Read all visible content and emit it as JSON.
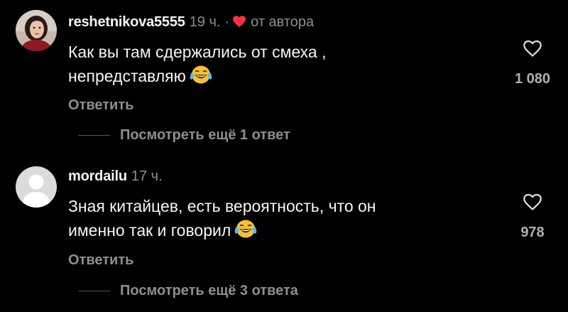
{
  "colors": {
    "background": "#000000",
    "text": "#f5f5f5",
    "muted": "#8e8e8e",
    "heart_red": "#ff3040"
  },
  "comments": [
    {
      "username": "reshetnikova5555",
      "time": "19 ч.",
      "separator": "·",
      "author_like": "от автора",
      "text_line1": "Как вы там сдержались от смеха ,",
      "text_line2": "непредставляю",
      "emoji": "face-with-tears-of-joy-icon",
      "reply_label": "Ответить",
      "view_replies_label": "Посмотреть ещё 1 ответ",
      "like_count": "1 080"
    },
    {
      "username": "mordailu",
      "time": "17 ч.",
      "text_line1": "Зная китайцев, есть вероятность, что он",
      "text_line2": "именно так и говорил",
      "emoji": "face-with-tears-of-joy-icon",
      "reply_label": "Ответить",
      "view_replies_label": "Посмотреть ещё 3 ответа",
      "like_count": "978"
    }
  ]
}
